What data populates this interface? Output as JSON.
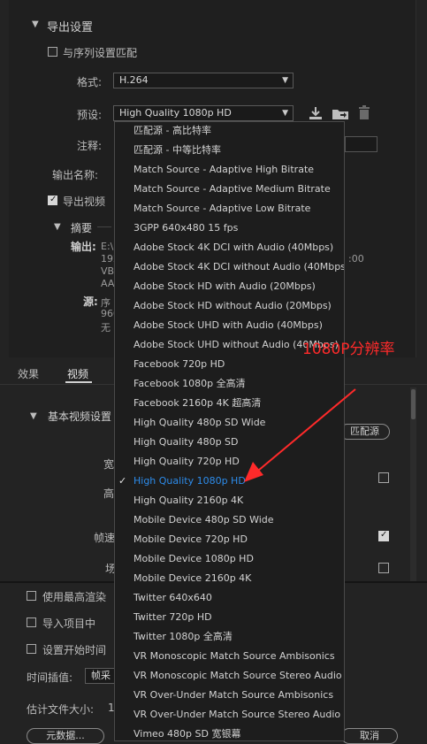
{
  "export": {
    "header": "导出设置",
    "match_sequence": "与序列设置匹配",
    "format_label": "格式:",
    "format_value": "H.264",
    "preset_label": "预设:",
    "preset_value": "High Quality 1080p HD",
    "comment_label": "注释:",
    "output_name_label": "输出名称:",
    "export_video": "导出视频",
    "summary_header": "摘要",
    "output_label": "输出:",
    "output_lines": [
      "E:\\",
      "192",
      "VB",
      "AA"
    ],
    "output_time": ":00",
    "source_label": "源:",
    "source_lines": [
      "序",
      "960",
      "无"
    ]
  },
  "tabs": {
    "effects": "效果",
    "video": "视频"
  },
  "basic_video": {
    "header": "基本视频设置",
    "match_source_btn": "匹配源",
    "width_label": "宽",
    "height_label": "高",
    "frame_rate_label": "帧速",
    "field_label": "场"
  },
  "bottom": {
    "max_render": "使用最高渲染",
    "import_project": "导入项目中",
    "set_start_time": "设置开始时间",
    "time_interp_label": "时间插值:",
    "time_interp_value": "帧采",
    "est_size_label": "估计文件大小:",
    "est_size_value": "1",
    "metadata_btn": "元数据...",
    "cancel_btn": "取消"
  },
  "preset_menu": {
    "items": [
      "匹配源 - 高比特率",
      "匹配源 - 中等比特率",
      "Match Source - Adaptive High Bitrate",
      "Match Source - Adaptive Medium Bitrate",
      "Match Source - Adaptive Low Bitrate",
      "3GPP 640x480 15 fps",
      "Adobe Stock 4K DCI with Audio (40Mbps)",
      "Adobe Stock 4K DCI without Audio (40Mbps)",
      "Adobe Stock HD with Audio (20Mbps)",
      "Adobe Stock HD without Audio (20Mbps)",
      "Adobe Stock UHD with Audio (40Mbps)",
      "Adobe Stock UHD without Audio (40Mbps)",
      "Facebook 720p HD",
      "Facebook 1080p 全高清",
      "Facebook 2160p 4K 超高清",
      "High Quality 480p SD Wide",
      "High Quality 480p SD",
      "High Quality 720p HD",
      "High Quality 1080p HD",
      "High Quality 2160p 4K",
      "Mobile Device 480p SD Wide",
      "Mobile Device 720p HD",
      "Mobile Device 1080p HD",
      "Mobile Device 2160p 4K",
      "Twitter 640x640",
      "Twitter 720p HD",
      "Twitter 1080p 全高清",
      "VR Monoscopic Match Source Ambisonics",
      "VR Monoscopic Match Source Stereo Audio",
      "VR Over-Under Match Source Ambisonics",
      "VR Over-Under Match Source Stereo Audio",
      "Vimeo 480p SD 宽银幕"
    ],
    "selected_index": 18
  },
  "annotation": {
    "text": "1080P分辨率",
    "color": "#ff2a2a"
  },
  "colors": {
    "selected_item": "#2d8ceb",
    "background": "#232323"
  }
}
